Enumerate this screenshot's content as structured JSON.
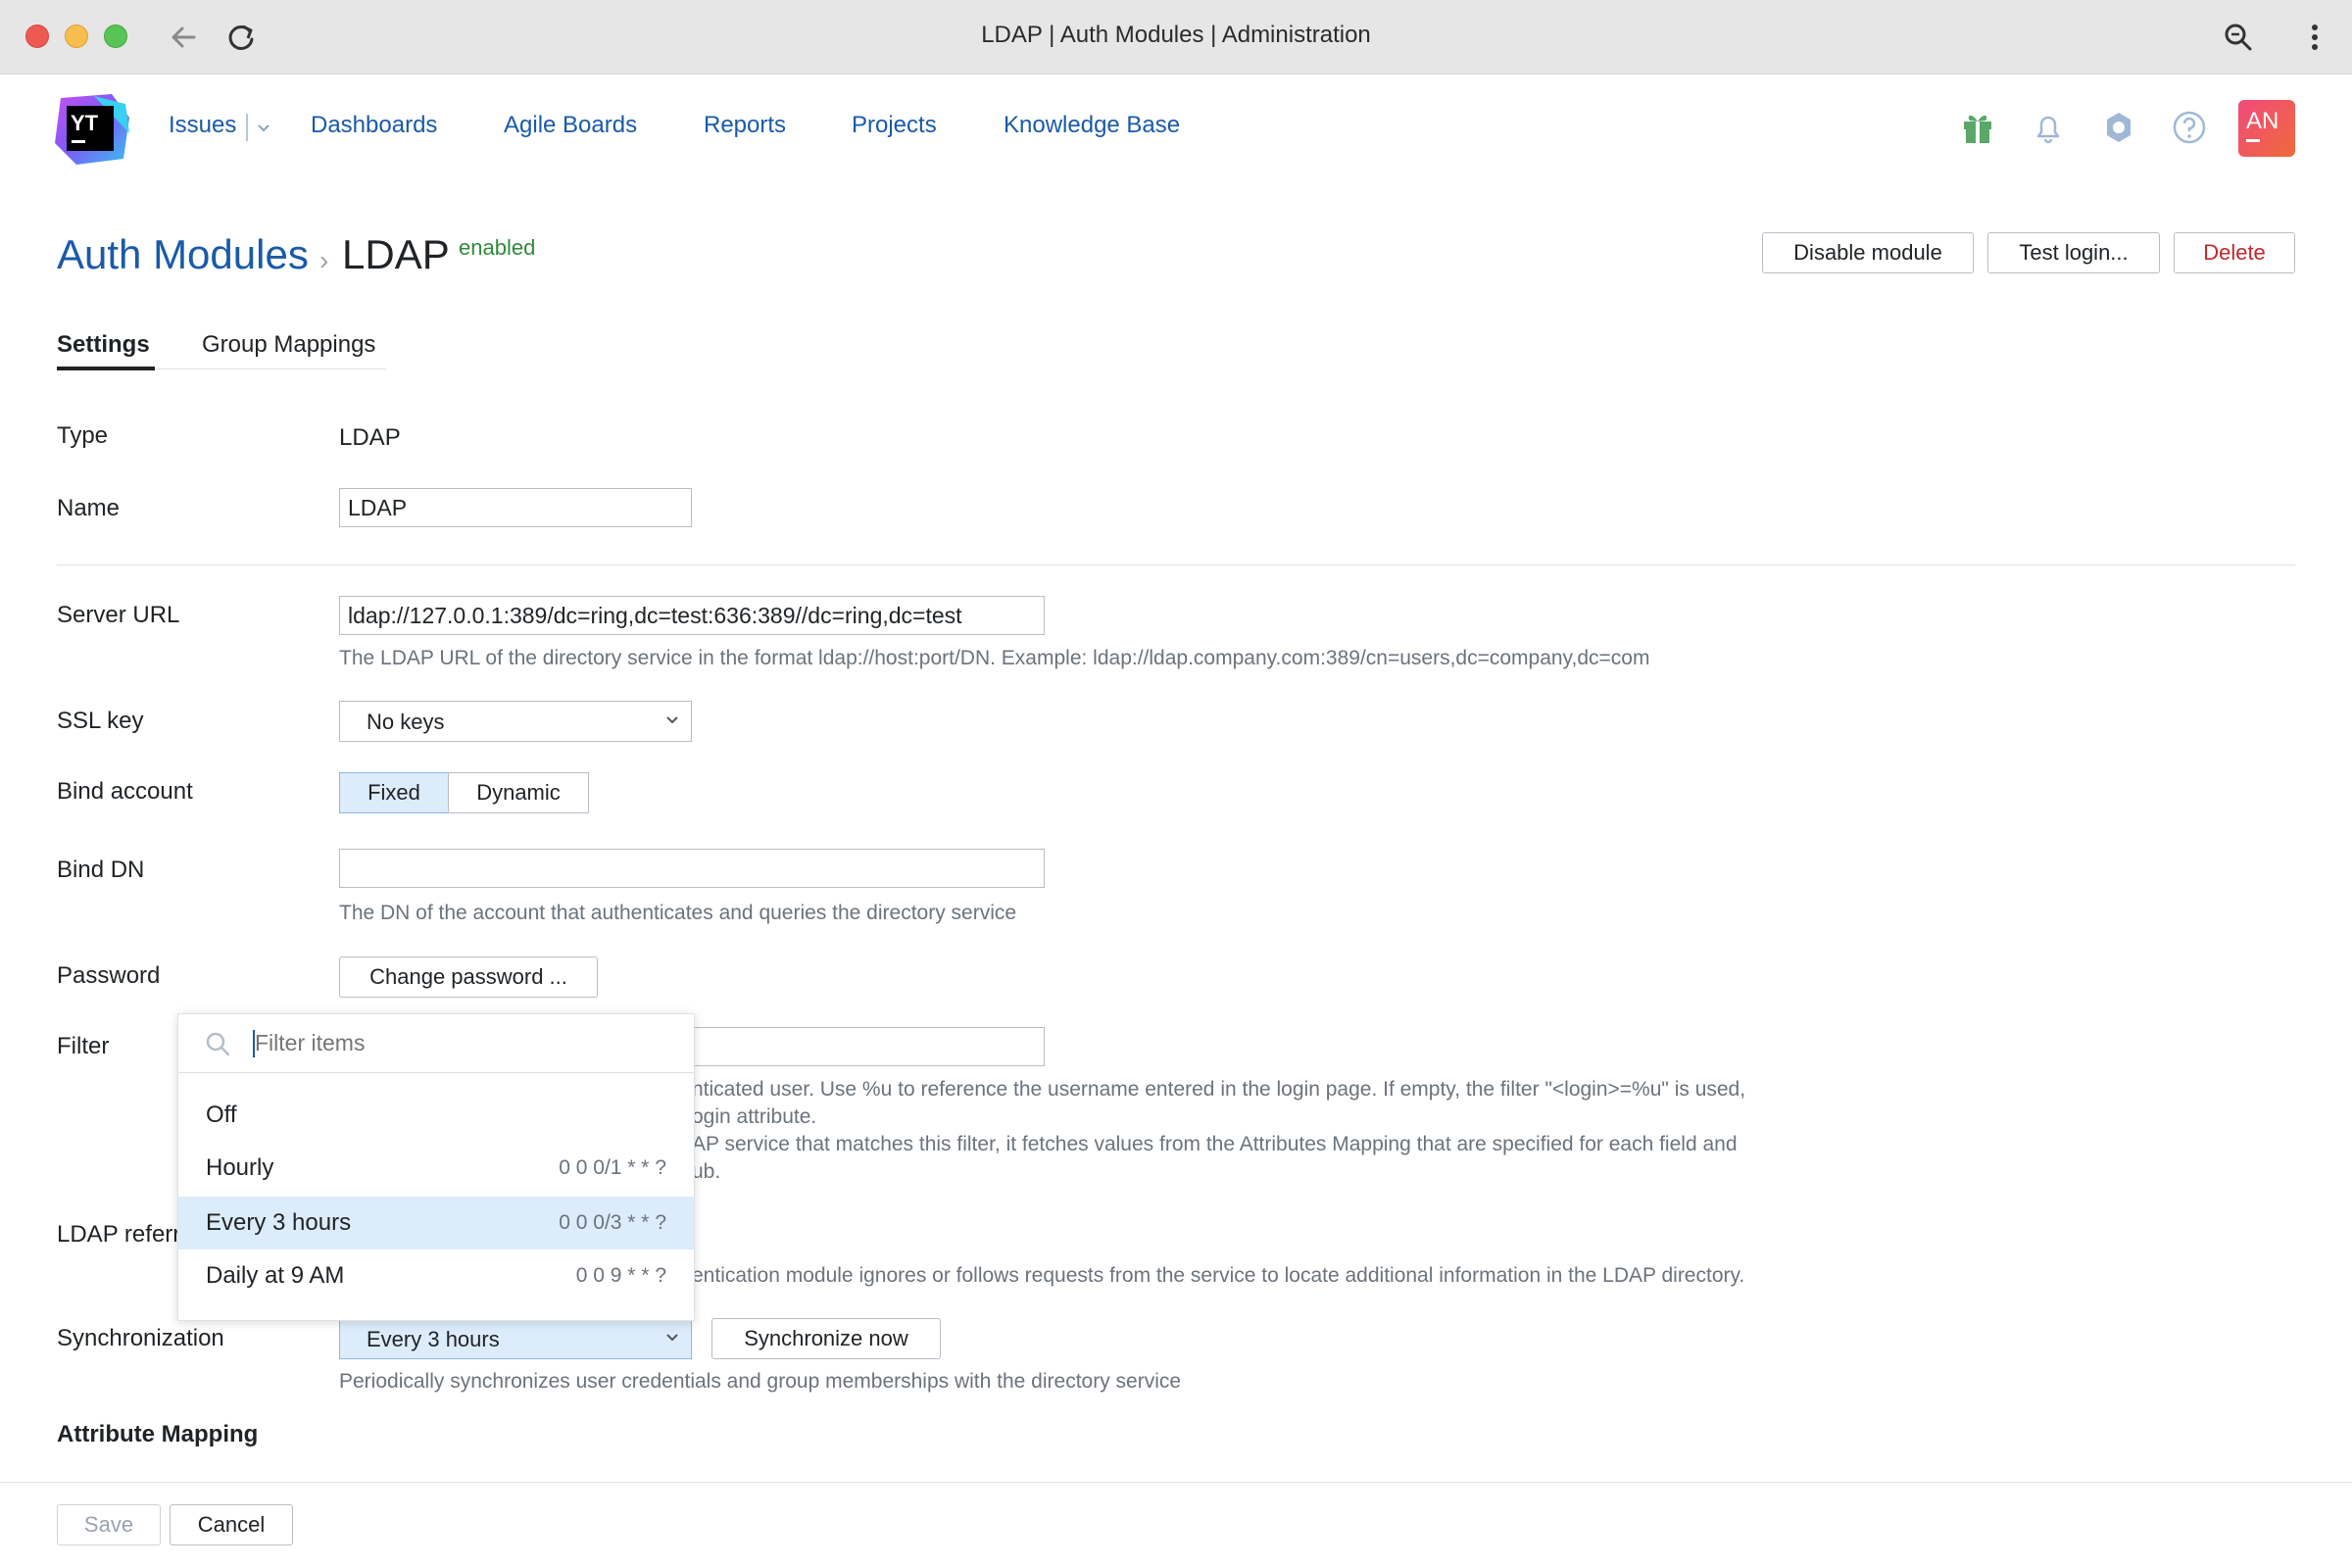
{
  "browser": {
    "title": "LDAP | Auth Modules | Administration"
  },
  "nav": {
    "items": [
      "Issues",
      "Dashboards",
      "Agile Boards",
      "Reports",
      "Projects",
      "Knowledge Base"
    ]
  },
  "header": {
    "avatar_initials": "AN"
  },
  "breadcrumb": {
    "parent": "Auth Modules",
    "separator": "›",
    "current": "LDAP",
    "status": "enabled"
  },
  "actions": {
    "disable": "Disable module",
    "test_login": "Test login...",
    "delete": "Delete"
  },
  "tabs": {
    "settings": "Settings",
    "group_mappings": "Group Mappings"
  },
  "form": {
    "type_label": "Type",
    "type_value": "LDAP",
    "name_label": "Name",
    "name_value": "LDAP",
    "server_url_label": "Server URL",
    "server_url_value": "ldap://127.0.0.1:389/dc=ring,dc=test:636:389//dc=ring,dc=test",
    "server_url_hint": "The LDAP URL of the directory service in the format ldap://host:port/DN. Example: ldap://ldap.company.com:389/cn=users,dc=company,dc=com",
    "ssl_key_label": "SSL key",
    "ssl_key_value": "No keys",
    "bind_account_label": "Bind account",
    "bind_fixed": "Fixed",
    "bind_dynamic": "Dynamic",
    "bind_dn_label": "Bind DN",
    "bind_dn_value": "",
    "bind_dn_hint": "The DN of the account that authenticates and queries the directory service",
    "password_label": "Password",
    "change_password": "Change password ...",
    "filter_label": "Filter",
    "filter_hint_1": "nticated user. Use %u to reference the username entered in the login page. If empty, the filter \"<login>=%u\" is used,",
    "filter_hint_2": "ogin attribute.",
    "filter_hint_3": "AP service that matches this filter, it fetches values from the Attributes Mapping that are specified for each field and",
    "filter_hint_4": "ub.",
    "referrals_label": "LDAP referr",
    "referrals_hint": "entication module ignores or follows requests from the service to locate additional information in the LDAP directory.",
    "sync_label": "Synchronization",
    "sync_value": "Every 3 hours",
    "sync_now": "Synchronize now",
    "sync_hint": "Periodically synchronizes user credentials and group memberships with the directory service",
    "attribute_mapping": "Attribute Mapping"
  },
  "footer": {
    "save": "Save",
    "cancel": "Cancel"
  },
  "dropdown": {
    "filter_placeholder": "Filter items",
    "options": [
      {
        "label": "Off",
        "cron": ""
      },
      {
        "label": "Hourly",
        "cron": "0 0 0/1 * * ?"
      },
      {
        "label": "Every 3 hours",
        "cron": "0 0 0/3 * * ?"
      },
      {
        "label": "Daily at 9 AM",
        "cron": "0 0 9 * * ?"
      }
    ],
    "selected": "Every 3 hours"
  },
  "colors": {
    "link": "#1a5aa8",
    "enabled": "#2e8b3a",
    "danger": "#c0282d",
    "selection": "#dcecfb",
    "gift": "#59a869"
  }
}
